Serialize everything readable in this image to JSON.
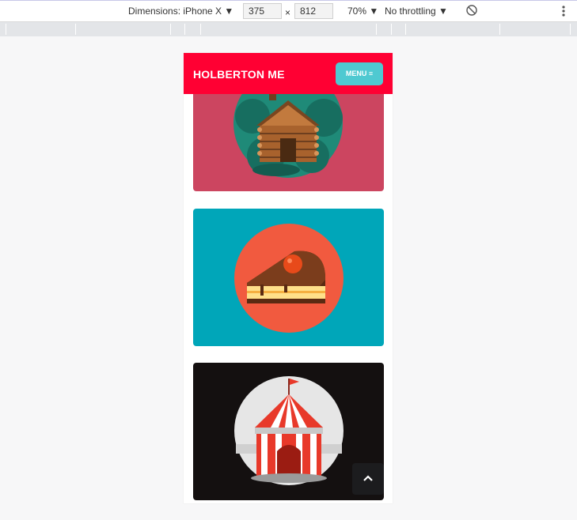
{
  "devtools": {
    "device_label": "Dimensions: iPhone X",
    "width_value": "375",
    "times_symbol": "×",
    "height_value": "812",
    "zoom_label": "70%",
    "throttle_label": "No throttling",
    "rotate_icon": "rotate-icon",
    "more_icon": "more-vertical-icon"
  },
  "site": {
    "brand": "HOLBERTON ME",
    "menu_label": "MENU ≡"
  },
  "cards": [
    {
      "name": "log-cabin",
      "background": "#cc4560",
      "circle": "#1f8a78"
    },
    {
      "name": "cake-slice",
      "background": "#00a6b9",
      "circle": "#f15a3f"
    },
    {
      "name": "circus-tent",
      "background": "#141010",
      "circle": "#e6e6e6"
    }
  ],
  "colors": {
    "header": "#ff0033",
    "menu_button": "#4fc9d1",
    "scroll_top_button": "#1c1c1e"
  }
}
